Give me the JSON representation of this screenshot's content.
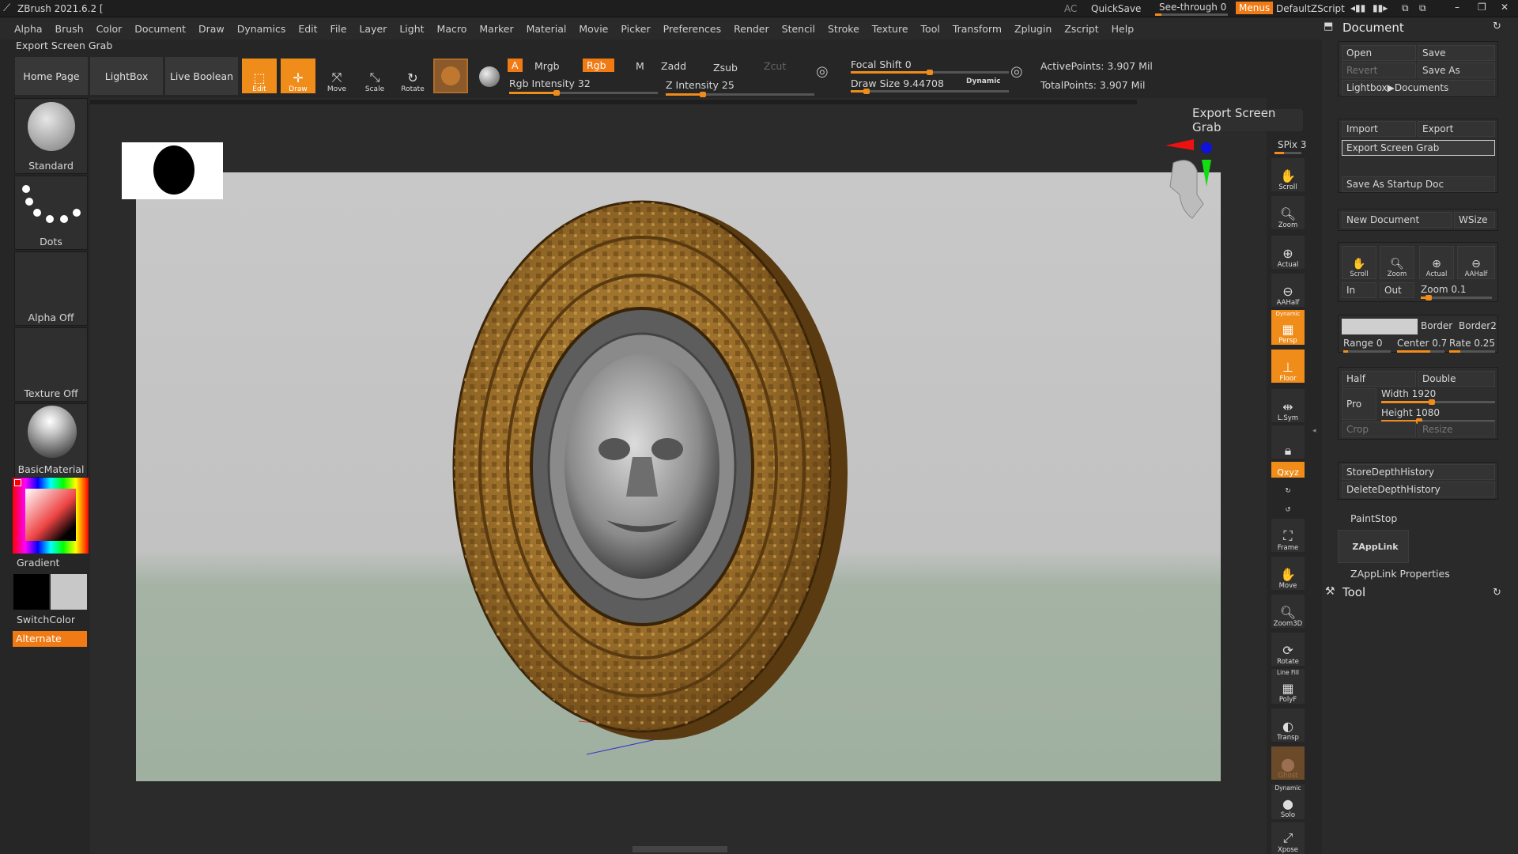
{
  "app": {
    "title": "ZBrush 2021.6.2 [",
    "ac": "AC",
    "quicksave": "QuickSave",
    "seethrough": "See-through  0",
    "menus": "Menus",
    "script": "DefaultZScript"
  },
  "menu": [
    "Alpha",
    "Brush",
    "Color",
    "Document",
    "Draw",
    "Dynamics",
    "Edit",
    "File",
    "Layer",
    "Light",
    "Macro",
    "Marker",
    "Material",
    "Movie",
    "Picker",
    "Preferences",
    "Render",
    "Stencil",
    "Stroke",
    "Texture",
    "Tool",
    "Transform",
    "Zplugin",
    "Zscript",
    "Help"
  ],
  "hint": "Export Screen Grab",
  "toolbar": {
    "home": "Home Page",
    "lightbox": "LightBox",
    "liveboolean": "Live Boolean",
    "edit": "Edit",
    "draw": "Draw",
    "move": "Move",
    "scale": "Scale",
    "rotate": "Rotate",
    "a": "A",
    "mrgb": "Mrgb",
    "rgb": "Rgb",
    "m": "M",
    "zadd": "Zadd",
    "zsub": "Zsub",
    "zcut": "Zcut",
    "rgb_intensity": "Rgb Intensity 32",
    "z_intensity": "Z Intensity 25",
    "focal_shift": "Focal Shift 0",
    "draw_size": "Draw Size 9.44708",
    "dynamic": "Dynamic",
    "active_points": "ActivePoints: 3.907 Mil",
    "total_points": "TotalPoints: 3.907 Mil",
    "rgb_intensity_value": 32,
    "z_intensity_value": 25
  },
  "left": {
    "standard": "Standard",
    "dots": "Dots",
    "alpha": "Alpha Off",
    "texture": "Texture Off",
    "material": "BasicMaterial",
    "gradient": "Gradient",
    "switchcolor": "SwitchColor",
    "alternate": "Alternate"
  },
  "shelf": {
    "spix": "SPix 3",
    "scroll": "Scroll",
    "zoom": "Zoom",
    "actual": "Actual",
    "aahalf": "AAHalf",
    "persp": "Persp",
    "dynamic": "Dynamic",
    "floor": "Floor",
    "lsym": "L.Sym",
    "xyz": "Qxyz",
    "frame": "Frame",
    "move": "Move",
    "zoom3d": "Zoom3D",
    "rotate": "Rotate",
    "linefill": "Line Fill",
    "polyf": "PolyF",
    "transp": "Transp",
    "ghost": "Ghost",
    "dynamic2": "Dynamic",
    "solo": "Solo",
    "xpose": "Xpose"
  },
  "tooltip": "Export Screen Grab",
  "panel": {
    "title": "Document",
    "open": "Open",
    "save": "Save",
    "revert": "Revert",
    "saveas": "Save As",
    "lightbox_docs": "Lightbox▶Documents",
    "import": "Import",
    "export": "Export",
    "exportgrab": "Export Screen Grab",
    "startup": "Save As Startup Doc",
    "newdoc": "New Document",
    "wsize": "WSize",
    "scroll": "Scroll",
    "zoom": "Zoom",
    "actual": "Actual",
    "aahalf": "AAHalf",
    "in": "In",
    "out": "Out",
    "zoomval": "Zoom 0.1",
    "border": "Border",
    "border2": "Border2",
    "range": "Range 0",
    "center": "Center 0.7",
    "rate": "Rate 0.25",
    "half": "Half",
    "double": "Double",
    "pro": "Pro",
    "width": "Width 1920",
    "height": "Height 1080",
    "crop": "Crop",
    "resize": "Resize",
    "storedepth": "StoreDepthHistory",
    "deletedepth": "DeleteDepthHistory",
    "paintstop": "PaintStop",
    "zapplink": "ZAppLink",
    "zapplinkprops": "ZAppLink Properties",
    "tool": "Tool"
  },
  "colors": {
    "accent": "#f08c1a",
    "bg": "#262626"
  }
}
